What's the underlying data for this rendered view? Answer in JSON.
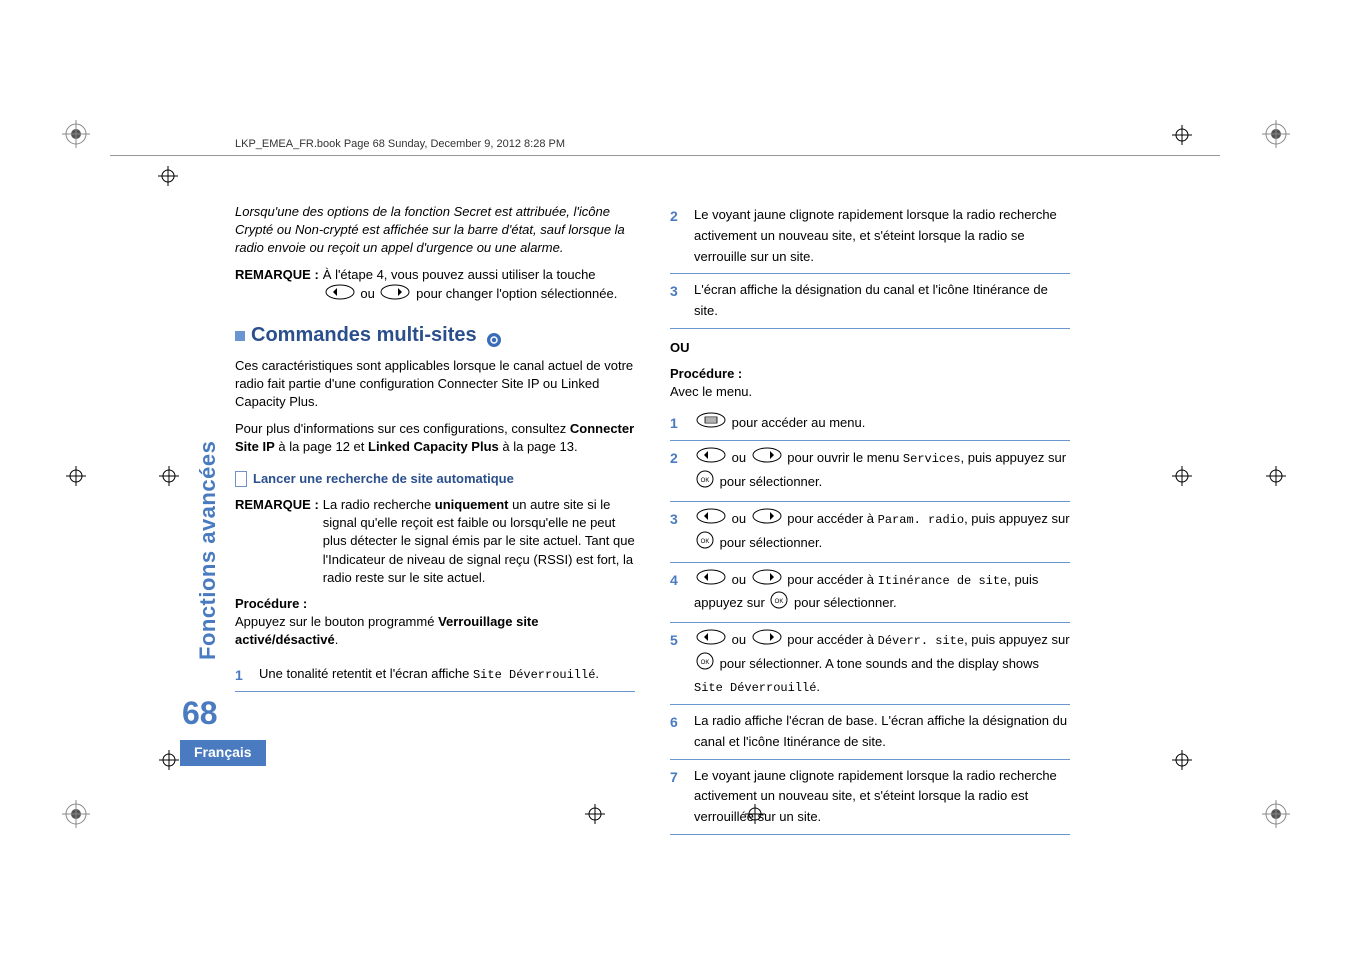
{
  "header": "LKP_EMEA_FR.book  Page 68  Sunday, December 9, 2012  8:28 PM",
  "sidebar_label": "Fonctions avancées",
  "page_number": "68",
  "lang_tab": "Français",
  "left": {
    "intro_italic": "Lorsqu'une des options de la fonction Secret est attribuée, l'icône Crypté ou Non-crypté est affichée sur la barre d'état, sauf lorsque la radio envoie ou reçoit un appel d'urgence ou une alarme.",
    "remarque1_label": "REMARQUE :",
    "remarque1_a": "À l'étape 4, vous pouvez aussi utiliser la touche",
    "remarque1_b": " ou ",
    "remarque1_c": " pour changer l'option sélectionnée.",
    "h2": "Commandes multi-sites",
    "para1": "Ces caractéristiques sont applicables lorsque le canal actuel de votre radio fait partie d'une configuration Connecter Site IP ou Linked Capacity Plus.",
    "para2_a": "Pour plus d'informations sur ces configurations, consultez ",
    "para2_b": "Connecter Site IP",
    "para2_c": " à la page 12 et ",
    "para2_d": "Linked Capacity Plus",
    "para2_e": " à la page 13.",
    "subsec": "Lancer une recherche de site automatique",
    "remarque2_label": "REMARQUE :",
    "remarque2_a": "La radio recherche ",
    "remarque2_b": "uniquement",
    "remarque2_c": " un autre site si le signal qu'elle reçoit est faible ou lorsqu'elle ne peut plus détecter le signal émis par le site actuel. Tant que l'Indicateur de niveau de signal reçu (RSSI) est fort, la radio reste sur le site actuel.",
    "proc_label": "Procédure :",
    "proc_body_a": "Appuyez sur le bouton programmé ",
    "proc_body_b": "Verrouillage site activé/désactivé",
    "proc_body_c": ".",
    "step1_a": "Une tonalité retentit et l'écran affiche ",
    "step1_b": "Site Déverrouillé",
    "step1_c": "."
  },
  "right": {
    "step2": "Le voyant jaune clignote rapidement lorsque la radio recherche activement un nouveau site, et s'éteint lorsque la radio se verrouille sur un site.",
    "step3": "L'écran affiche la désignation du canal et l'icône Itinérance de site.",
    "ou": "OU",
    "proc_label": "Procédure :",
    "avec_menu": "Avec le menu.",
    "s1": " pour accéder au menu.",
    "s2a": " ou ",
    "s2b": " pour ouvrir le menu ",
    "s2c": "Services",
    "s2d": ", puis appuyez sur ",
    "s2e": " pour sélectionner.",
    "s3a": " ou ",
    "s3b": " pour accéder à ",
    "s3c": "Param. radio",
    "s3d": ", puis appuyez sur ",
    "s3e": " pour sélectionner.",
    "s4a": " ou ",
    "s4b": " pour accéder à ",
    "s4c": "Itinérance de site",
    "s4d": ", puis appuyez sur ",
    "s4e": " pour sélectionner.",
    "s5a": " ou ",
    "s5b": " pour accéder à ",
    "s5c": "Déverr. site",
    "s5d": ", puis appuyez sur ",
    "s5e": " pour sélectionner. A tone sounds and the display shows ",
    "s5f": "Site Déverrouillé",
    "s5g": ".",
    "s6": "La radio affiche l'écran de base. L'écran affiche la désignation du canal et l'icône Itinérance de site.",
    "s7": "Le voyant jaune clignote rapidement lorsque la radio recherche activement un nouveau site, et s'éteint lorsque la radio est verrouillée sur un site."
  }
}
